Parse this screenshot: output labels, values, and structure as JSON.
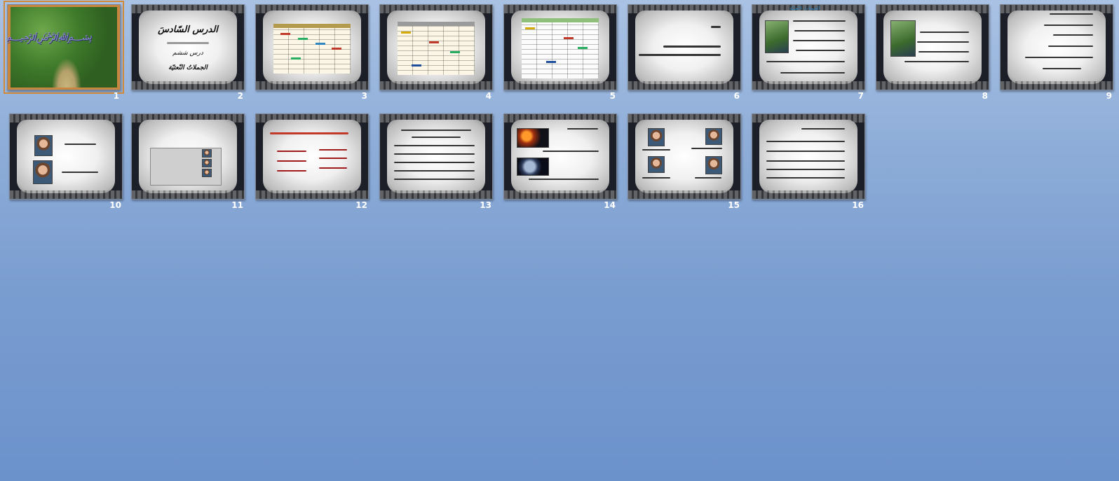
{
  "slides": [
    {
      "num": "1",
      "title": "",
      "subtitle": "",
      "footer": ""
    },
    {
      "num": "2",
      "title": "الدرس السّادسَ",
      "subtitle": "درس ششم",
      "footer": "الجملاتُ النّعتيّة"
    },
    {
      "num": "3"
    },
    {
      "num": "4"
    },
    {
      "num": "5"
    },
    {
      "num": "6"
    },
    {
      "num": "7",
      "header": "الجملاتُ النّعتيّة"
    },
    {
      "num": "8"
    },
    {
      "num": "9"
    },
    {
      "num": "10"
    },
    {
      "num": "11"
    },
    {
      "num": "12"
    },
    {
      "num": "13"
    },
    {
      "num": "14"
    },
    {
      "num": "15"
    },
    {
      "num": "16"
    }
  ],
  "selected_slide": "1",
  "colors": {
    "selection": "#d08a3a",
    "background_top": "#a9c2e4",
    "background_bottom": "#6c92cc"
  }
}
